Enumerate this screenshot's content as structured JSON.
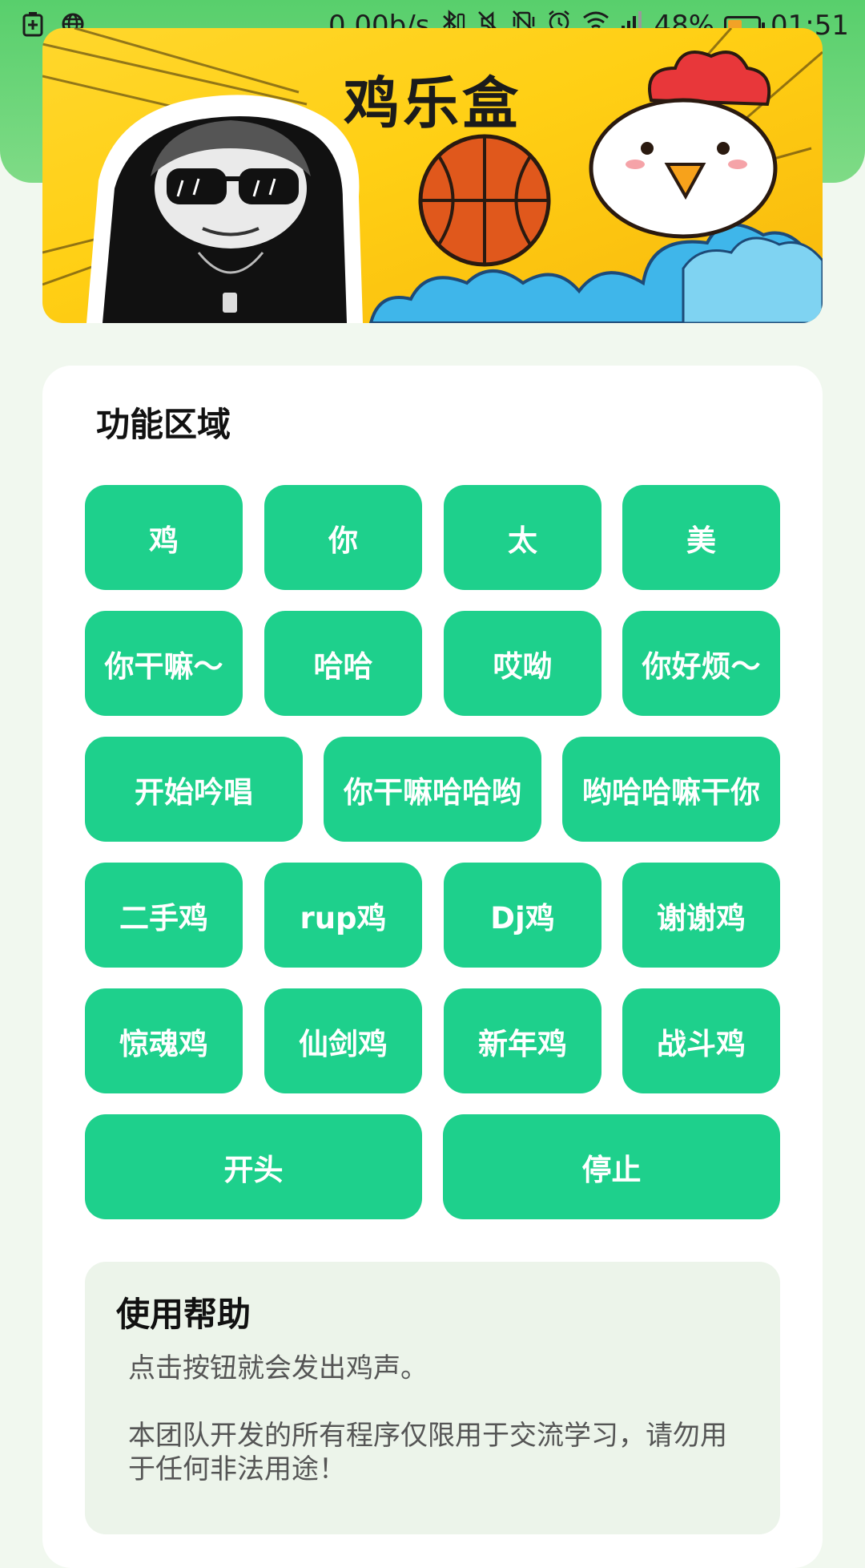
{
  "status_bar": {
    "net_speed": "0.00b/s",
    "battery_percent": "48%",
    "battery_level": 0.48,
    "time": "01:51",
    "icons": [
      "battery-saver-icon",
      "globe-icon",
      "bluetooth-icon",
      "mute-icon",
      "vibrate-off-icon",
      "alarm-icon",
      "wifi-icon",
      "signal-icon",
      "battery-icon"
    ]
  },
  "banner": {
    "title": "鸡乐盒",
    "images": [
      "panda-meme-icon",
      "basketball-icon",
      "chicken-icon"
    ]
  },
  "functions": {
    "title": "功能区域",
    "buttons": [
      "鸡",
      "你",
      "太",
      "美",
      "你干嘛～",
      "哈哈",
      "哎呦",
      "你好烦～",
      "开始吟唱",
      "你干嘛哈哈哟",
      "哟哈哈嘛干你",
      "二手鸡",
      "rup鸡",
      "Dj鸡",
      "谢谢鸡",
      "惊魂鸡",
      "仙剑鸡",
      "新年鸡",
      "战斗鸡",
      "开头",
      "停止"
    ]
  },
  "help": {
    "title": "使用帮助",
    "line1": "点击按钮就会发出鸡声。",
    "line2": "本团队开发的所有程序仅限用于交流学习，请勿用于任何非法用途！"
  },
  "colors": {
    "header_green": "#58cf6c",
    "button_green": "#1ed08c",
    "page_bg": "#f1f8ef",
    "banner_yellow": "#ffd72c"
  }
}
